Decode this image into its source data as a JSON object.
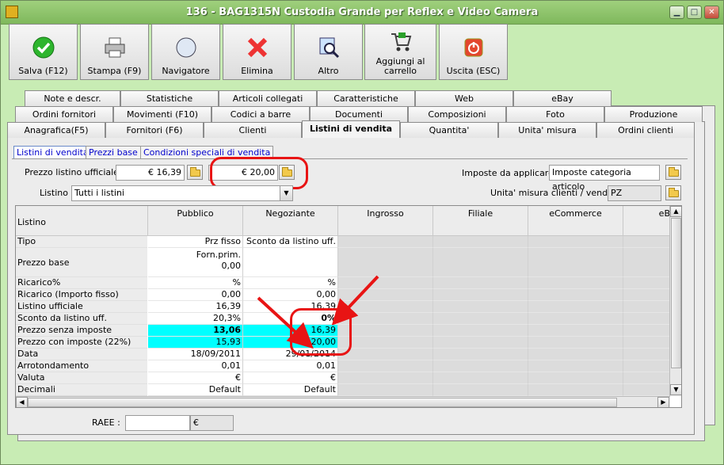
{
  "window": {
    "title": "136 - BAG1315N Custodia Grande per Reflex e Video Camera"
  },
  "toolbar": [
    {
      "label": "Salva (F12)",
      "icon": "check-icon"
    },
    {
      "label": "Stampa (F9)",
      "icon": "printer-icon"
    },
    {
      "label": "Navigatore",
      "icon": "compass-icon"
    },
    {
      "label": "Elimina",
      "icon": "delete-x-icon"
    },
    {
      "label": "Altro",
      "icon": "magnifier-icon"
    },
    {
      "label": "Aggiungi al carrello",
      "icon": "cart-icon"
    },
    {
      "label": "Uscita (ESC)",
      "icon": "power-icon"
    }
  ],
  "tabs": {
    "row1": [
      "Note e descr.",
      "Statistiche",
      "Articoli collegati",
      "Caratteristiche",
      "Web",
      "eBay"
    ],
    "row2": [
      "Ordini fornitori",
      "Movimenti (F10)",
      "Codici a barre",
      "Documenti",
      "Composizioni",
      "Foto",
      "Produzione"
    ],
    "row3": [
      "Anagrafica(F5)",
      "Fornitori (F6)",
      "Clienti",
      "Listini di vendita",
      "Quantita'",
      "Unita' misura",
      "Ordini clienti"
    ]
  },
  "subtabs": [
    "Listini di vendita",
    "Prezzi base",
    "Condizioni speciali di vendita"
  ],
  "form": {
    "prezzo_label": "Prezzo listino ufficiale :",
    "prezzo_value1": "€ 16,39",
    "prezzo_value2": "€ 20,00",
    "imposte_label": "Imposte da applicare :",
    "imposte_value": "Imposte categoria articolo",
    "listino_label": "Listino :",
    "listino_value": "Tutti i listini",
    "unita_label": "Unita' misura clienti / vendita :",
    "unita_value": "PZ",
    "raee_label": "RAEE :",
    "raee_value": "",
    "raee_currency": "€"
  },
  "grid": {
    "corner": "Listino",
    "columns": [
      "Pubblico",
      "Negoziante",
      "Ingrosso",
      "Filiale",
      "eCommerce",
      "eB"
    ],
    "rows": [
      {
        "label": "Tipo",
        "pub": "Prz fisso",
        "neg": "Sconto da listino uff."
      },
      {
        "label": "Prezzo base",
        "pub": "Forn.prim.",
        "pub2": "0,00",
        "neg": ""
      },
      {
        "label": "Ricarico%",
        "pub": "%",
        "neg": "%"
      },
      {
        "label": "Ricarico (Importo fisso)",
        "pub": "0,00",
        "neg": "0,00"
      },
      {
        "label": "Listino ufficiale",
        "pub": "16,39",
        "neg": "16,39"
      },
      {
        "label": "Sconto da listino uff.",
        "pub": "20,3%",
        "neg": "0%"
      },
      {
        "label": "Prezzo senza imposte",
        "pub": "13,06",
        "neg": "16,39"
      },
      {
        "label": "Prezzo con imposte (22%)",
        "pub": "15,93",
        "neg": "20,00"
      },
      {
        "label": "Data",
        "pub": "18/09/2011",
        "neg": "29/01/2014"
      },
      {
        "label": "Arrotondamento",
        "pub": "0,01",
        "neg": "0,01"
      },
      {
        "label": "Valuta",
        "pub": "€",
        "neg": "€"
      },
      {
        "label": "Decimali",
        "pub": "Default",
        "neg": "Default"
      }
    ]
  },
  "colors": {
    "highlight": "#00ffff",
    "annotation": "#e81414",
    "window_bg": "#c8ecb4"
  }
}
